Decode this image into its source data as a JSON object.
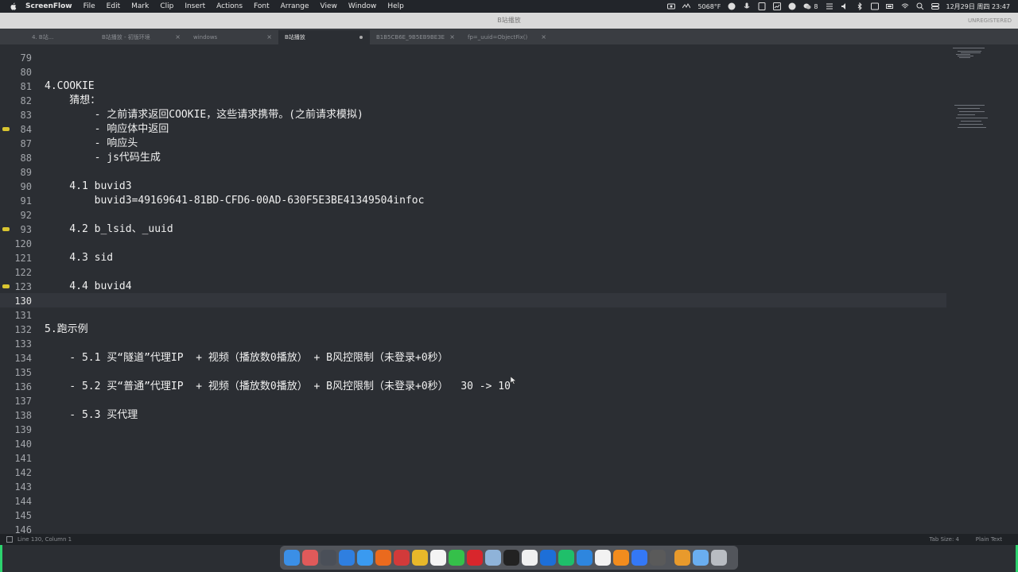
{
  "menubar": {
    "app_name": "ScreenFlow",
    "items": [
      "File",
      "Edit",
      "Mark",
      "Clip",
      "Insert",
      "Actions",
      "Font",
      "Arrange",
      "View",
      "Window",
      "Help"
    ],
    "status": {
      "temp": "5068°F",
      "chat_count": "8",
      "datetime": "12月29日 周四 23:47"
    }
  },
  "window": {
    "title": "B站播放",
    "unregistered": "UNREGISTERED"
  },
  "tabs": [
    {
      "label": "4. B站...",
      "active": false
    },
    {
      "label": "B站播放 - 初版环境",
      "active": false
    },
    {
      "label": "windows",
      "active": false
    },
    {
      "label": "B站播放",
      "active": true
    },
    {
      "label": "B1B5CB6E_9B5EB9BE3E",
      "active": false
    },
    {
      "label": "fp=_uuid=ObjectFix()",
      "active": false
    }
  ],
  "editor": {
    "lines": [
      {
        "n": "79",
        "t": ""
      },
      {
        "n": "80",
        "t": ""
      },
      {
        "n": "81",
        "t": "4.COOKIE"
      },
      {
        "n": "82",
        "t": "    猜想："
      },
      {
        "n": "83",
        "t": "        - 之前请求返回COOKIE，这些请求携带。(之前请求模拟)"
      },
      {
        "n": "84",
        "t": "        - 响应体中返回",
        "fold": true
      },
      {
        "n": "87",
        "t": "        - 响应头"
      },
      {
        "n": "88",
        "t": "        - js代码生成"
      },
      {
        "n": "89",
        "t": ""
      },
      {
        "n": "90",
        "t": "    4.1 buvid3"
      },
      {
        "n": "91",
        "t": "        buvid3=49169641-81BD-CFD6-00AD-630F5E3BE41349504infoc"
      },
      {
        "n": "92",
        "t": ""
      },
      {
        "n": "93",
        "t": "    4.2 b_lsid、_uuid",
        "fold": true
      },
      {
        "n": "120",
        "t": ""
      },
      {
        "n": "121",
        "t": "    4.3 sid"
      },
      {
        "n": "122",
        "t": ""
      },
      {
        "n": "123",
        "t": "    4.4 buvid4",
        "fold": true
      },
      {
        "n": "130",
        "t": "",
        "current": true
      },
      {
        "n": "131",
        "t": ""
      },
      {
        "n": "132",
        "t": "5.跑示例"
      },
      {
        "n": "133",
        "t": ""
      },
      {
        "n": "134",
        "t": "    - 5.1 买“隧道”代理IP  + 视频（播放数0播放） + B风控限制（未登录+0秒）"
      },
      {
        "n": "135",
        "t": ""
      },
      {
        "n": "136",
        "t": "    - 5.2 买“普通”代理IP  + 视频（播放数0播放） + B风控限制（未登录+0秒）  30 -> 10"
      },
      {
        "n": "137",
        "t": ""
      },
      {
        "n": "138",
        "t": "    - 5.3 买代理"
      },
      {
        "n": "139",
        "t": ""
      },
      {
        "n": "140",
        "t": ""
      },
      {
        "n": "141",
        "t": ""
      },
      {
        "n": "142",
        "t": ""
      },
      {
        "n": "143",
        "t": ""
      },
      {
        "n": "144",
        "t": ""
      },
      {
        "n": "145",
        "t": ""
      },
      {
        "n": "146",
        "t": ""
      }
    ]
  },
  "statusbar": {
    "position": "Line 130, Column 1",
    "tab_size": "Tab Size: 4",
    "syntax": "Plain Text"
  },
  "colors": {
    "fold_marker": "#d9c530",
    "edge": "#2dd36f",
    "editor_bg": "#2b2e33"
  }
}
